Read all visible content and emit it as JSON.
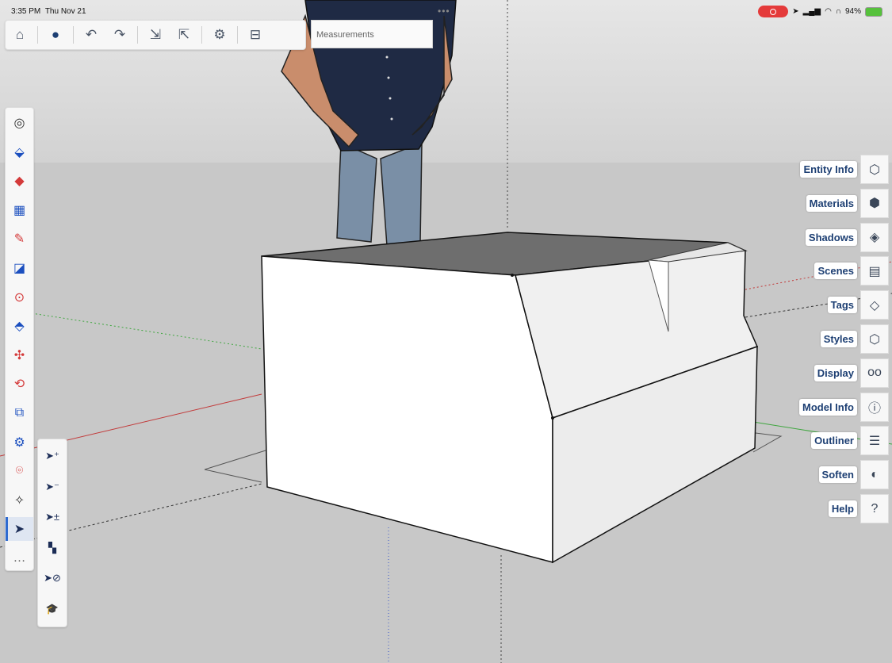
{
  "status": {
    "time": "3:35 PM",
    "date": "Thu Nov 21",
    "battery": "94%",
    "dots": "•••"
  },
  "toolbar": {
    "measurements_placeholder": "Measurements",
    "buttons": [
      "home-icon",
      "user-icon",
      "undo-icon",
      "redo-icon",
      "import-icon",
      "export-icon",
      "settings-icon",
      "view-icon"
    ]
  },
  "tools": [
    {
      "name": "orbit-tool",
      "glyph": "◎",
      "color": "#333"
    },
    {
      "name": "paint-bucket-tool",
      "glyph": "⬙",
      "color": "#1b4fbf"
    },
    {
      "name": "eraser-tool",
      "glyph": "◆",
      "color": "#d43a3a"
    },
    {
      "name": "shape-tool",
      "glyph": "▦",
      "color": "#1b4fbf"
    },
    {
      "name": "pencil-tool",
      "glyph": "✎",
      "color": "#d43a3a"
    },
    {
      "name": "line-tool",
      "glyph": "◪",
      "color": "#1b4fbf"
    },
    {
      "name": "circle-tool",
      "glyph": "⊙",
      "color": "#d43a3a"
    },
    {
      "name": "push-pull-tool",
      "glyph": "⬘",
      "color": "#1b4fbf"
    },
    {
      "name": "move-tool",
      "glyph": "✣",
      "color": "#d43a3a"
    },
    {
      "name": "rotate-tool",
      "glyph": "⟲",
      "color": "#d43a3a"
    },
    {
      "name": "scale-tool",
      "glyph": "⧉",
      "color": "#1b4fbf"
    },
    {
      "name": "tape-measure-tool",
      "glyph": "⚙",
      "color": "#1b4fbf"
    },
    {
      "name": "search-tool",
      "glyph": "⌾",
      "color": "#d43a3a"
    },
    {
      "name": "axes-tool",
      "glyph": "✧",
      "color": "#333"
    },
    {
      "name": "select-tool",
      "glyph": "➤",
      "color": "#1b2c56",
      "active": true
    },
    {
      "name": "more-tools",
      "glyph": "…",
      "color": "#555"
    }
  ],
  "select_subtools": [
    {
      "name": "select-add-icon",
      "glyph": "➤⁺"
    },
    {
      "name": "select-subtract-icon",
      "glyph": "➤⁻"
    },
    {
      "name": "select-toggle-icon",
      "glyph": "➤±"
    },
    {
      "name": "select-all-icon",
      "glyph": "▚"
    },
    {
      "name": "select-none-icon",
      "glyph": "➤⊘"
    },
    {
      "name": "select-tutorial-icon",
      "glyph": "🎓"
    }
  ],
  "panels": [
    {
      "label": "Entity Info",
      "icon": "entity-info-icon",
      "glyph": "⬡"
    },
    {
      "label": "Materials",
      "icon": "materials-icon",
      "glyph": "⬢"
    },
    {
      "label": "Shadows",
      "icon": "shadows-icon",
      "glyph": "◈"
    },
    {
      "label": "Scenes",
      "icon": "scenes-icon",
      "glyph": "▤"
    },
    {
      "label": "Tags",
      "icon": "tags-icon",
      "glyph": "◇"
    },
    {
      "label": "Styles",
      "icon": "styles-icon",
      "glyph": "⬡"
    },
    {
      "label": "Display",
      "icon": "display-icon",
      "glyph": "oo"
    },
    {
      "label": "Model Info",
      "icon": "model-info-icon",
      "glyph": "ⓘ"
    },
    {
      "label": "Outliner",
      "icon": "outliner-icon",
      "glyph": "☰"
    },
    {
      "label": "Soften",
      "icon": "soften-icon",
      "glyph": "◐"
    },
    {
      "label": "Help",
      "icon": "help-icon",
      "glyph": "?"
    }
  ]
}
